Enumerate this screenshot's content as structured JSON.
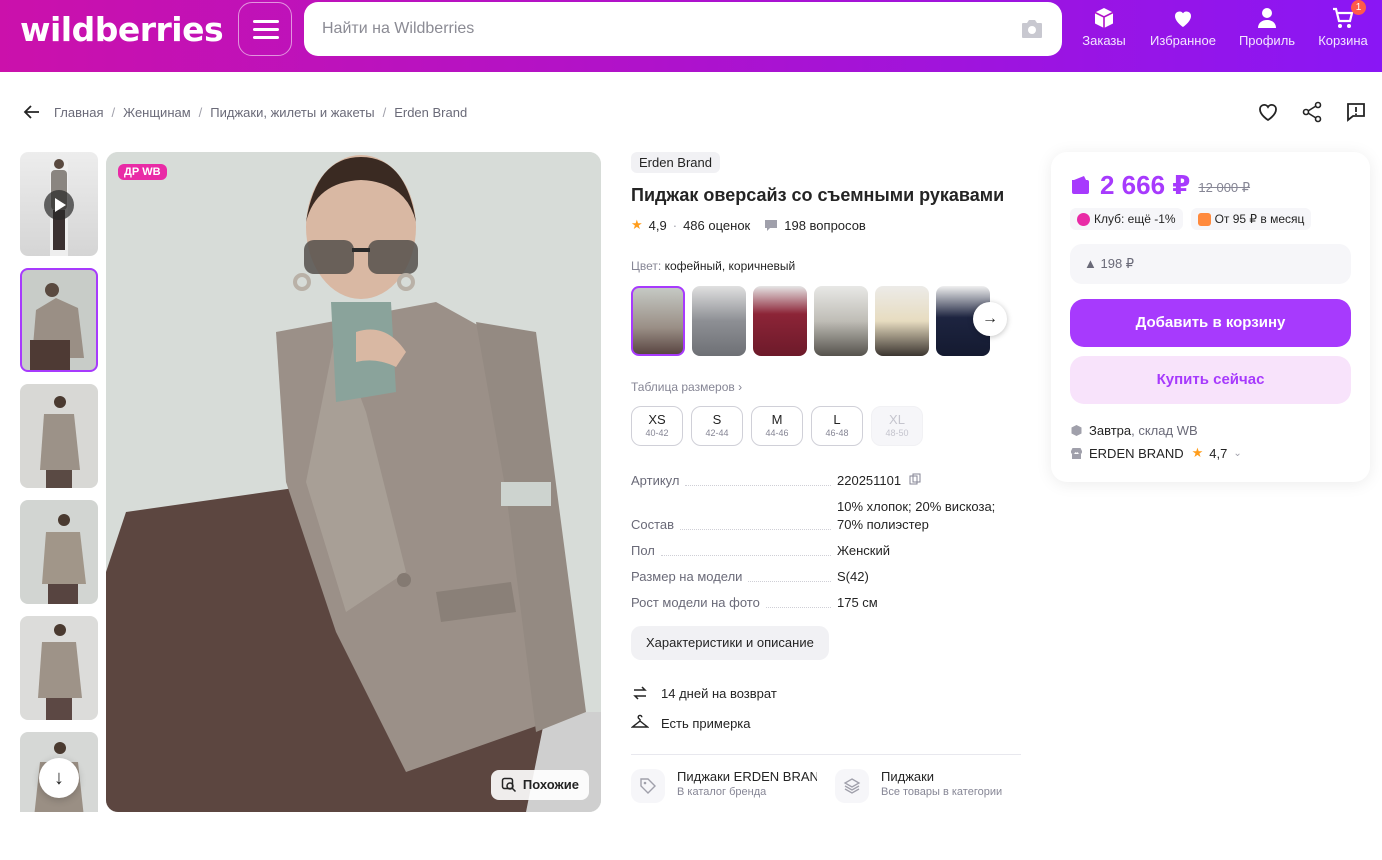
{
  "header": {
    "logo": "wildberries",
    "search_placeholder": "Найти на Wildberries",
    "nav": [
      {
        "label": "Заказы",
        "icon": "box-icon"
      },
      {
        "label": "Избранное",
        "icon": "heart-icon"
      },
      {
        "label": "Профиль",
        "icon": "user-icon"
      },
      {
        "label": "Корзина",
        "icon": "cart-icon",
        "badge": "1"
      }
    ]
  },
  "breadcrumb": [
    "Главная",
    "Женщинам",
    "Пиджаки, жилеты и жакеты",
    "Erden Brand"
  ],
  "gallery": {
    "badge": "ДР WB",
    "similar_label": "Похожие"
  },
  "product": {
    "brand": "Erden Brand",
    "title": "Пиджак оверсайз со съемными рукавами",
    "rating": "4,9",
    "reviews": "486 оценок",
    "questions": "198 вопросов",
    "color_label": "Цвет:",
    "color_value": "кофейный, коричневый",
    "size_table_label": "Таблица размеров",
    "sizes": [
      {
        "name": "XS",
        "range": "40-42",
        "available": true
      },
      {
        "name": "S",
        "range": "42-44",
        "available": true
      },
      {
        "name": "M",
        "range": "44-46",
        "available": true
      },
      {
        "name": "L",
        "range": "46-48",
        "available": true
      },
      {
        "name": "XL",
        "range": "48-50",
        "available": false
      }
    ],
    "specs": [
      {
        "key": "Артикул",
        "value": "220251101"
      },
      {
        "key": "Состав",
        "value": "10% хлопок; 20% вискоза; 70% полиэстер"
      },
      {
        "key": "Пол",
        "value": "Женский"
      },
      {
        "key": "Размер на модели",
        "value": "S(42)"
      },
      {
        "key": "Рост модели на фото",
        "value": "175 см"
      }
    ],
    "characteristics_button": "Характеристики и описание",
    "features": [
      "14 дней на возврат",
      "Есть примерка"
    ],
    "categories": [
      {
        "title": "Пиджаки ERDEN BRAND",
        "subtitle": "В каталог бренда"
      },
      {
        "title": "Пиджаки",
        "subtitle": "Все товары в категории"
      }
    ]
  },
  "buy_card": {
    "price": "2 666 ₽",
    "old_price": "12 000 ₽",
    "club_tag": "Клуб: ещё -1%",
    "installment_tag": "От 95 ₽ в месяц",
    "bonus": "▲ 198 ₽",
    "add_to_cart": "Добавить в корзину",
    "buy_now": "Купить сейчас",
    "delivery_day": "Завтра",
    "delivery_from": ", склад WB",
    "seller": "ERDEN BRAND",
    "seller_rating": "4,7"
  },
  "colors": {
    "accent": "#a73afd",
    "header_start": "#cb11ab",
    "header_end": "#8a16f5"
  }
}
